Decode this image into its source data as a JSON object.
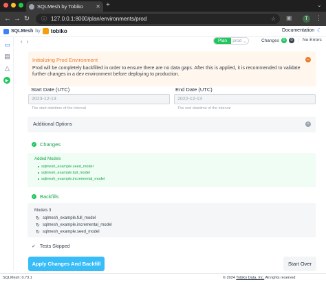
{
  "browser": {
    "tab_title": "SQLMesh by Tobiko",
    "url": "127.0.0.1:8000/plan/environments/prod",
    "profile_initial": "T",
    "window_dots": [
      "#ff5f57",
      "#febc2e",
      "#28c840"
    ]
  },
  "header": {
    "brand_name": "SQLMesh",
    "brand_by": "by",
    "brand_company": "tobiko",
    "docs_label": "Documentation"
  },
  "toolbar": {
    "plan_label": "Plan",
    "env_label": "prod",
    "changes_label": "Changes",
    "changes_count_a": "0",
    "changes_count_b": "0",
    "errors_label": "No Errors"
  },
  "alert": {
    "title": "Initializing Prod Environment",
    "body": "Prod will be completely backfilled in order to ensure there are no data gaps. After this is applied, it is recommended to validate further changes in a dev environment before deploying to production."
  },
  "form": {
    "start_label": "Start Date (UTC)",
    "start_value": "2023-12-13",
    "start_help": "The start datetime of the interval",
    "end_label": "End Date (UTC)",
    "end_value": "2022-12-13",
    "end_help": "The end datetime of the interval",
    "additional_label": "Additional Options"
  },
  "changes_section": {
    "title": "Changes",
    "added_title": "Added Models",
    "models": [
      "sqlmesh_example.seed_model",
      "sqlmesh_example.full_model",
      "sqlmesh_example.incremental_model"
    ]
  },
  "backfills_section": {
    "title": "Backfills",
    "count_label": "Models 3",
    "models": [
      "sqlmesh_example.full_model",
      "sqlmesh_example.incremental_model",
      "sqlmesh_example.seed_model"
    ]
  },
  "tests": {
    "label": "Tests Skipped"
  },
  "actions": {
    "apply_label": "Apply Changes And Backfill",
    "start_over_label": "Start Over"
  },
  "footer": {
    "version": "SQLMesh: 0.73.1",
    "copyright_prefix": "© 2024",
    "company_link": "Tobiko Data, Inc.",
    "rights": "All rights reserved"
  },
  "colors": {
    "accent_green": "#22c55e",
    "accent_blue": "#38bdf8",
    "alert_orange": "#ea7c2e"
  }
}
